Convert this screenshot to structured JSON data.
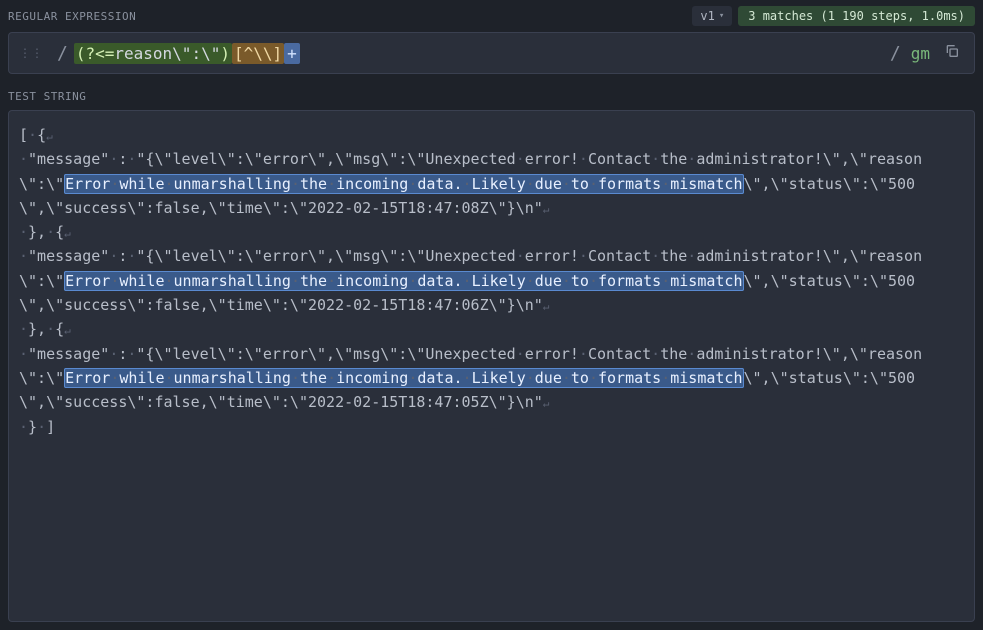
{
  "section": {
    "regex_label": "REGULAR EXPRESSION",
    "test_label": "TEST STRING"
  },
  "version": {
    "label": "v1"
  },
  "matches": {
    "text": "3 matches (1 190 steps, 1.0ms)"
  },
  "regex": {
    "delimiter_open": "/",
    "delimiter_close": "/",
    "lookbehind_open": "(?<=",
    "literal": "reason\\\":\\\"",
    "lookbehind_close": ")",
    "charclass": "[^\\\\]",
    "quantifier": "+",
    "flags": "gm"
  },
  "test_string": {
    "entries": [
      {
        "prefix_open": "[",
        "brace": "{",
        "msg_key": "\"message\"",
        "colon": ":",
        "msg_prefix": "\"{\\\"level\\\":\\\"error\\\",\\\"msg\\\":\\\"Unexpected",
        "word_error": "error!",
        "word_contact": "Contact",
        "word_the": "the",
        "word_admin": "administrator!\\\",\\\"reason\\\":\\\"",
        "match_words": [
          "Error",
          "while",
          "unmarshalling",
          "the",
          "incoming",
          "data.",
          "Likely",
          "due",
          "to",
          "formats",
          "mismatch"
        ],
        "suffix": "\\\",\\\"status\\\":\\\"500\\\",\\\"success\\\":false,\\\"time\\\":\\\"2022-02-15T18:47:08Z\\\"}\\n\"",
        "close": "},"
      },
      {
        "brace": "{",
        "msg_key": "\"message\"",
        "colon": ":",
        "msg_prefix": "\"{\\\"level\\\":\\\"error\\\",\\\"msg\\\":\\\"Unexpected",
        "word_error": "error!",
        "word_contact": "Contact",
        "word_the": "the",
        "word_admin": "administrator!\\\",\\\"reason\\\":\\\"",
        "match_words": [
          "Error",
          "while",
          "unmarshalling",
          "the",
          "incoming",
          "data.",
          "Likely",
          "due",
          "to",
          "formats",
          "mismatch"
        ],
        "suffix": "\\\",\\\"status\\\":\\\"500\\\",\\\"success\\\":false,\\\"time\\\":\\\"2022-02-15T18:47:06Z\\\"}\\n\"",
        "close": "},"
      },
      {
        "brace": "{",
        "msg_key": "\"message\"",
        "colon": ":",
        "msg_prefix": "\"{\\\"level\\\":\\\"error\\\",\\\"msg\\\":\\\"Unexpected",
        "word_error": "error!",
        "word_contact": "Contact",
        "word_the": "the",
        "word_admin": "administrator!\\\",\\\"reason\\\":\\\"",
        "match_words": [
          "Error",
          "while",
          "unmarshalling",
          "the",
          "incoming",
          "data.",
          "Likely",
          "due",
          "to",
          "formats",
          "mismatch"
        ],
        "suffix": "\\\",\\\"status\\\":\\\"500\\\",\\\"success\\\":false,\\\"time\\\":\\\"2022-02-15T18:47:05Z\\\"}\\n\"",
        "close": "}",
        "suffix_close": "]"
      }
    ]
  }
}
